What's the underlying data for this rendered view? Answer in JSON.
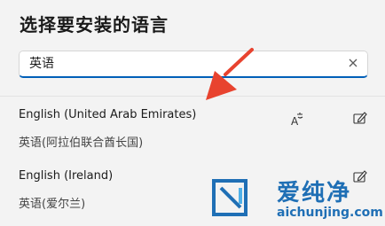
{
  "dialog": {
    "title": "选择要安装的语言"
  },
  "search": {
    "value": "英语",
    "clear_icon": "close-icon",
    "accent_color": "#005fb8"
  },
  "languages": [
    {
      "name": "English (United Arab Emirates)",
      "native": "英语(阿拉伯联合酋长国)",
      "features": [
        "text-to-speech-icon",
        "handwriting-icon"
      ]
    },
    {
      "name": "English (Ireland)",
      "native": "英语(爱尔兰)",
      "features": [
        "handwriting-icon"
      ]
    }
  ],
  "annotation": {
    "arrow_color": "#e8432f"
  },
  "watermark": {
    "brand": "爱纯净",
    "site": "aichunjing.com",
    "color": "#1f6fb5"
  }
}
